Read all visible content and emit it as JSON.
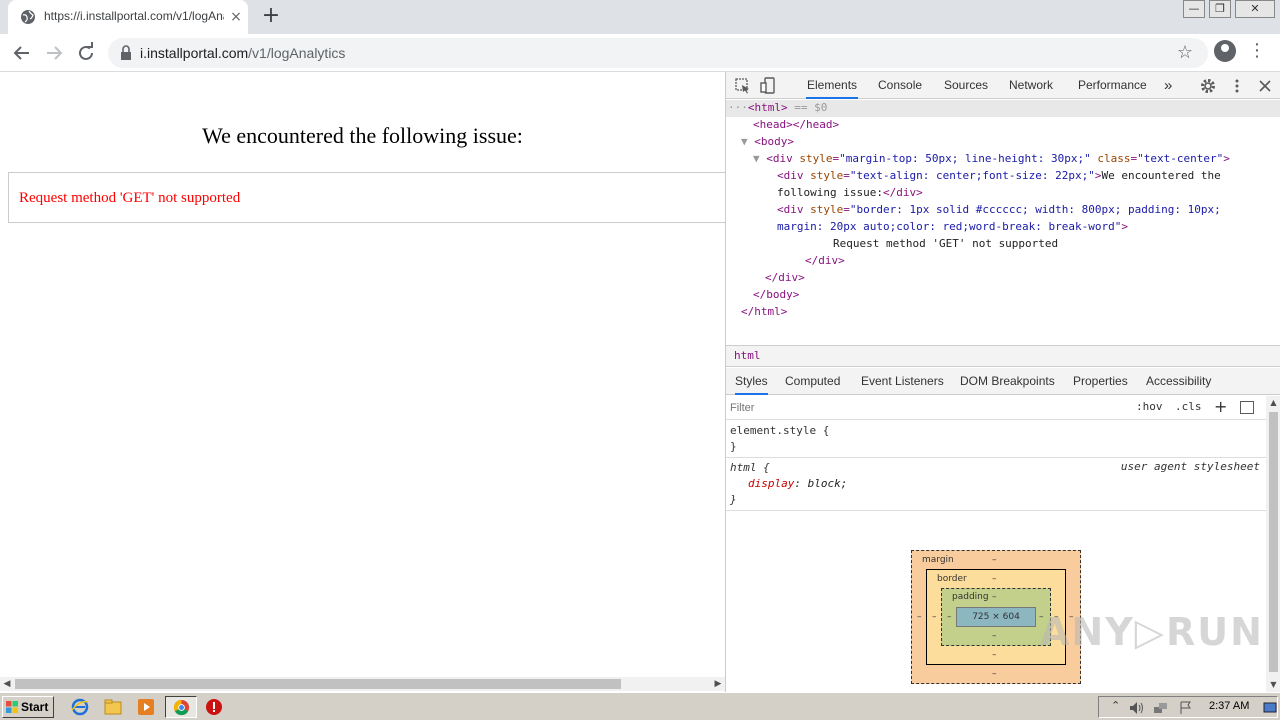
{
  "browser": {
    "tab_title": "https://i.installportal.com/v1/logAna",
    "tab_close": "×",
    "new_tab": "+",
    "url_domain": "i.installportal.com",
    "url_path": "/v1/logAnalytics",
    "star": "☆",
    "menu": "⋮",
    "window": {
      "min": "—",
      "max": "❐",
      "close": "✕"
    }
  },
  "page": {
    "heading": "We encountered the following issue:",
    "error": "Request method 'GET' not supported"
  },
  "devtools": {
    "tabs": [
      "Elements",
      "Console",
      "Sources",
      "Network",
      "Performance"
    ],
    "more_tabs": "»",
    "dom": {
      "line1_prefix": "···",
      "line1_tag": "<html>",
      "line1_suffix": " == $0",
      "head": "<head></head>",
      "body_open": "<body>",
      "div1_tag": "<div ",
      "div1_attr1": "style",
      "div1_val1": "\"margin-top: 50px; line-height: 30px;\"",
      "div1_attr2": "class",
      "div1_val2": "\"text-center\"",
      "div2_tag": "<div ",
      "div2_attr": "style",
      "div2_val": "\"text-align: center;font-size: 22px;\"",
      "div2_text_a": "We encountered the",
      "div2_text_b": "following issue:",
      "div3_tag": "<div ",
      "div3_attr": "style",
      "div3_val_a": "\"border: 1px solid #cccccc; width: 800px; padding: 10px;",
      "div3_val_b": "margin: 20px auto;color: red;word-break: break-word\"",
      "div3_text": "Request method 'GET' not supported",
      "close_div": "</div>",
      "close_body": "</body>",
      "close_html": "</html>"
    },
    "breadcrumb": "html",
    "sub_tabs": [
      "Styles",
      "Computed",
      "Event Listeners",
      "DOM Breakpoints",
      "Properties",
      "Accessibility"
    ],
    "filter_placeholder": "Filter",
    "hov": ":hov",
    "cls": ".cls",
    "plus": "+",
    "rules": {
      "element_style": "element.style {",
      "close_brace": "}",
      "html_selector": "html {",
      "origin": "user agent stylesheet",
      "prop": "display",
      "value": "block;"
    },
    "box_model": {
      "margin_label": "margin",
      "border_label": "border",
      "padding_label": "padding",
      "content": "725 × 604",
      "dash": "–"
    }
  },
  "watermark": "ANY▷RUN",
  "taskbar": {
    "start": "Start",
    "clock": "2:37 AM"
  }
}
